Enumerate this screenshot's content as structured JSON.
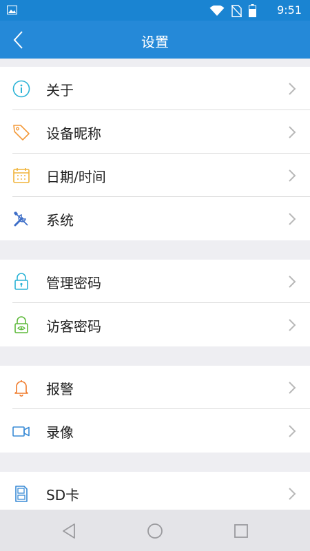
{
  "status_bar": {
    "time": "9:51"
  },
  "header": {
    "title": "设置"
  },
  "groups": [
    {
      "items": [
        {
          "label": "关于",
          "icon": "info-icon"
        },
        {
          "label": "设备昵称",
          "icon": "tag-icon"
        },
        {
          "label": "日期/时间",
          "icon": "calendar-icon"
        },
        {
          "label": "系统",
          "icon": "tools-icon"
        }
      ]
    },
    {
      "items": [
        {
          "label": "管理密码",
          "icon": "lock-icon"
        },
        {
          "label": "访客密码",
          "icon": "guest-lock-icon"
        }
      ]
    },
    {
      "items": [
        {
          "label": "报警",
          "icon": "bell-icon"
        },
        {
          "label": "录像",
          "icon": "video-icon"
        }
      ]
    },
    {
      "items": [
        {
          "label": "SD卡",
          "icon": "sdcard-icon"
        }
      ]
    }
  ],
  "colors": {
    "header": "#2589d8",
    "status_bar": "#1a84d2",
    "background": "#eeeef2",
    "info": "#2bb3d6",
    "tag": "#f39a3a",
    "calendar": "#f0b43a",
    "tools": "#3f6fc8",
    "lock": "#2bb3d6",
    "guest_lock": "#5fba3c",
    "bell": "#f07a2a",
    "video": "#3a8bd6",
    "sdcard": "#3a8bd6"
  }
}
